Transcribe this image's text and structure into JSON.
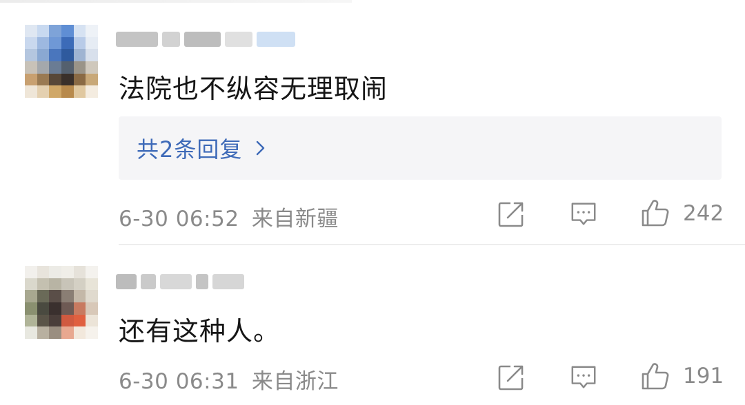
{
  "comments": [
    {
      "text": "法院也不纵容无理取闹",
      "replies_label": "共2条回复",
      "timestamp": "6-30 06:52",
      "location": "来自新疆",
      "likes": "242",
      "avatar_colors": [
        "#dfe7f2",
        "#c8d9f0",
        "#7ea3d8",
        "#5f8ed4",
        "#d6e2f2",
        "#eef2f7",
        "#c9d8ee",
        "#9db8e0",
        "#6f98d6",
        "#3c6bb8",
        "#b8cbe8",
        "#e6ecf4",
        "#b4c6df",
        "#8aa8d2",
        "#4a76bd",
        "#2f5a9e",
        "#9fb4d2",
        "#d8e0ec",
        "#c8c2b8",
        "#a4a8ac",
        "#6a7c94",
        "#54606e",
        "#9a9488",
        "#cfc8bc",
        "#c8a070",
        "#9a7a52",
        "#584838",
        "#3a302a",
        "#8a6a44",
        "#c8a878",
        "#efe6d8",
        "#e4d0b0",
        "#d0a868",
        "#b88a4c",
        "#e0c8a0",
        "#f4ece0"
      ],
      "name_blur_colors": [
        "#c4c4c4",
        "#d2d2d2",
        "#bdbdbd",
        "#e0e0e0",
        "#cfe0f4"
      ]
    },
    {
      "text": "还有这种人。",
      "timestamp": "6-30 06:31",
      "location": "来自浙江",
      "likes": "191",
      "avatar_colors": [
        "#f2f0ec",
        "#e8e4dc",
        "#ecebe6",
        "#f0eee8",
        "#e6e2da",
        "#f4f2ee",
        "#dad8cc",
        "#c4c0b0",
        "#b8b4a4",
        "#c8c4b8",
        "#d4d0c4",
        "#e8e4d8",
        "#a8a890",
        "#6a6a58",
        "#5a4e48",
        "#8a7e74",
        "#c4b8a8",
        "#e0dace",
        "#8a9070",
        "#4a4a40",
        "#3a302e",
        "#6e5a54",
        "#c87a60",
        "#d8c8b8",
        "#b0b498",
        "#5a5448",
        "#4a3e3a",
        "#d05a40",
        "#e06040",
        "#ece4d8",
        "#e8e8e0",
        "#b8b0a0",
        "#9a8e80",
        "#e8a890",
        "#f2e8dc",
        "#f6f2ec"
      ],
      "name_blur_colors": [
        "#bcbcbc",
        "#cacaca",
        "#d8d8d8",
        "#c4c4c4",
        "#d6d6d6"
      ]
    }
  ]
}
